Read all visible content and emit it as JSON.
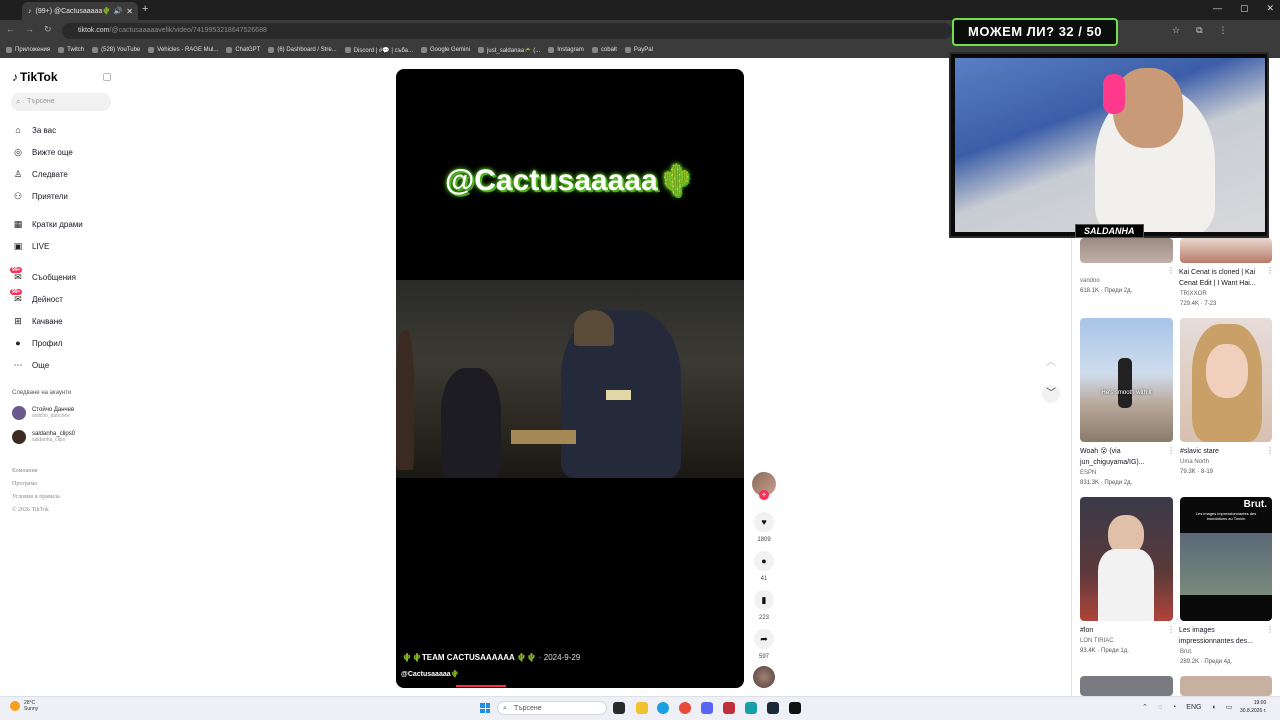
{
  "browser": {
    "tab_title": "(99+) @Cactusaaaaa🌵 | Ti",
    "url_host": "tiktok.com",
    "url_path": "/@cactusaaaaavelik/video/7419953218647526688",
    "bookmarks": [
      "Приложения",
      "Twitch",
      "(528) YouTube",
      "Vehicles - RAGE Mul...",
      "ChatGPT",
      "(6) Dashboard / Stre...",
      "Discord | #💬 | съба...",
      "Google Gemini",
      "just_saldanaa🥷 (...",
      "Instagram",
      "cobalt",
      "PayPal"
    ]
  },
  "sidebar": {
    "logo": "TikTok",
    "search_placeholder": "Търсене",
    "nav": [
      {
        "label": "За вас",
        "icon": "home-icon"
      },
      {
        "label": "Вижте още",
        "icon": "compass-icon"
      },
      {
        "label": "Следвате",
        "icon": "following-icon"
      },
      {
        "label": "Приятели",
        "icon": "friends-icon"
      },
      {
        "label": "Кратки драми",
        "icon": "drama-icon"
      },
      {
        "label": "LIVE",
        "icon": "live-icon"
      },
      {
        "label": "Съобщения",
        "icon": "messages-icon",
        "badge": "99+"
      },
      {
        "label": "Дейност",
        "icon": "activity-icon",
        "badge": "99+"
      },
      {
        "label": "Качване",
        "icon": "upload-icon"
      },
      {
        "label": "Профил",
        "icon": "profile-icon"
      },
      {
        "label": "Още",
        "icon": "more-icon"
      }
    ],
    "following_title": "Следване на акаунти",
    "accounts": [
      {
        "name": "Стойчо Данчев",
        "handle": "stoicho_danchev"
      },
      {
        "name": "saldanha_clips0",
        "handle": "saldanha_clips"
      }
    ],
    "footer": [
      "Компания",
      "Програма",
      "Условия и правила",
      "© 2026 TikTok"
    ]
  },
  "video": {
    "overlay_title": "@Cactusaaaaa🌵",
    "description": "🌵🌵TEAM CACTUSAAAAAA 🌵🌵",
    "date": "· 2024-9-29",
    "username": "@Cactusaaaaa🌵"
  },
  "actions": {
    "likes": "1809",
    "comments": "41",
    "saves": "223",
    "shares": "597"
  },
  "related": [
    {
      "title": "",
      "author": "vandoo",
      "stats": "618.1K · Преди 2д."
    },
    {
      "title": "Kai Cenat is cloned | Kai Cenat Edit | I Want Hai...",
      "author": "TRIXXOR",
      "stats": "729.4K · 7-23"
    },
    {
      "title": "Woah 😮 (via jun_chiguyama/IG)...",
      "author": "ESPN",
      "stats": "831.3K · Преди 2д."
    },
    {
      "title": "#slavic stare",
      "author": "Uma North",
      "stats": "79.3K · 8-19"
    },
    {
      "title": "#lon",
      "author": "LON TIRIAC",
      "stats": "93.4K · Преди 1д."
    },
    {
      "title": "Les images impressionnantes des...",
      "author": "Brut.",
      "stats": "289.2K · Преди 4д."
    }
  ],
  "thumb_captions": {
    "woah": "He's smooth with it",
    "brut_logo": "Brut.",
    "brut_text": "Les images impressionnantes des inondations au Tonkin"
  },
  "stream": {
    "goal": "МОЖЕМ ЛИ? 32 / 50",
    "streamer": "SALDANHA"
  },
  "taskbar": {
    "temp": "28°C",
    "weather": "Sunny",
    "search": "Търсене",
    "lang": "ENG",
    "time": "19:00",
    "date": "30.8.2026 г."
  }
}
